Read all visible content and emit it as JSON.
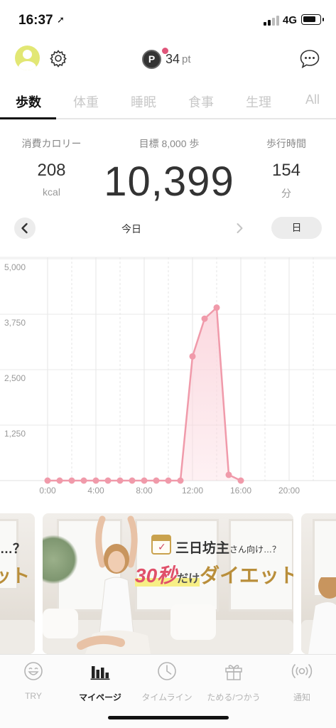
{
  "status": {
    "time": "16:37",
    "network": "4G",
    "battery_level": 0.8,
    "signal_bars": 2
  },
  "header": {
    "points_icon_letter": "P",
    "points_value": "34",
    "points_unit": "pt",
    "icons": [
      "avatar-icon",
      "gear-icon",
      "points-icon",
      "chat-icon"
    ]
  },
  "tabs": [
    {
      "label": "歩数",
      "active": true
    },
    {
      "label": "体重",
      "active": false
    },
    {
      "label": "睡眠",
      "active": false
    },
    {
      "label": "食事",
      "active": false
    },
    {
      "label": "生理",
      "active": false
    },
    {
      "label": "All",
      "active": false
    }
  ],
  "summary": {
    "calories_label": "消費カロリー",
    "calories_value": "208",
    "calories_unit": "kcal",
    "goal_label": "目標 8,000 歩",
    "steps_value": "10,399",
    "walk_time_label": "歩行時間",
    "walk_time_value": "154",
    "walk_time_unit": "分"
  },
  "period": {
    "label": "今日",
    "range": "日"
  },
  "chart_data": {
    "type": "area",
    "x_tick_labels": [
      "0:00",
      "4:00",
      "8:00",
      "12:00",
      "16:00",
      "20:00"
    ],
    "y_tick_labels": [
      "5,000",
      "3,750",
      "2,500",
      "1,250"
    ],
    "ylim": [
      0,
      5000
    ],
    "xlim": [
      0,
      24
    ],
    "x": [
      0,
      1,
      2,
      3,
      4,
      5,
      6,
      7,
      8,
      9,
      10,
      11,
      12,
      13,
      14,
      15,
      16
    ],
    "values": [
      0,
      0,
      0,
      0,
      0,
      0,
      0,
      0,
      0,
      0,
      0,
      0,
      2800,
      3650,
      3900,
      130,
      0
    ],
    "color": "#f09aaa",
    "fill_color": "#fbd7de",
    "grid": true
  },
  "banner": {
    "subtitle": "三日坊主",
    "subtitle_small": "さん向け…？",
    "main_pink": "30秒",
    "main_small": "だけ",
    "main_gold": "ダイエット",
    "left_edge_top": "…？",
    "left_edge_main": "ット"
  },
  "tabbar": [
    {
      "label": "TRY",
      "icon": "smile-icon",
      "active": false
    },
    {
      "label": "マイページ",
      "icon": "bar-chart-icon",
      "active": true
    },
    {
      "label": "タイムライン",
      "icon": "clock-icon",
      "active": false
    },
    {
      "label": "ためる/つかう",
      "icon": "gift-icon",
      "active": false
    },
    {
      "label": "通知",
      "icon": "broadcast-icon",
      "active": false
    }
  ]
}
